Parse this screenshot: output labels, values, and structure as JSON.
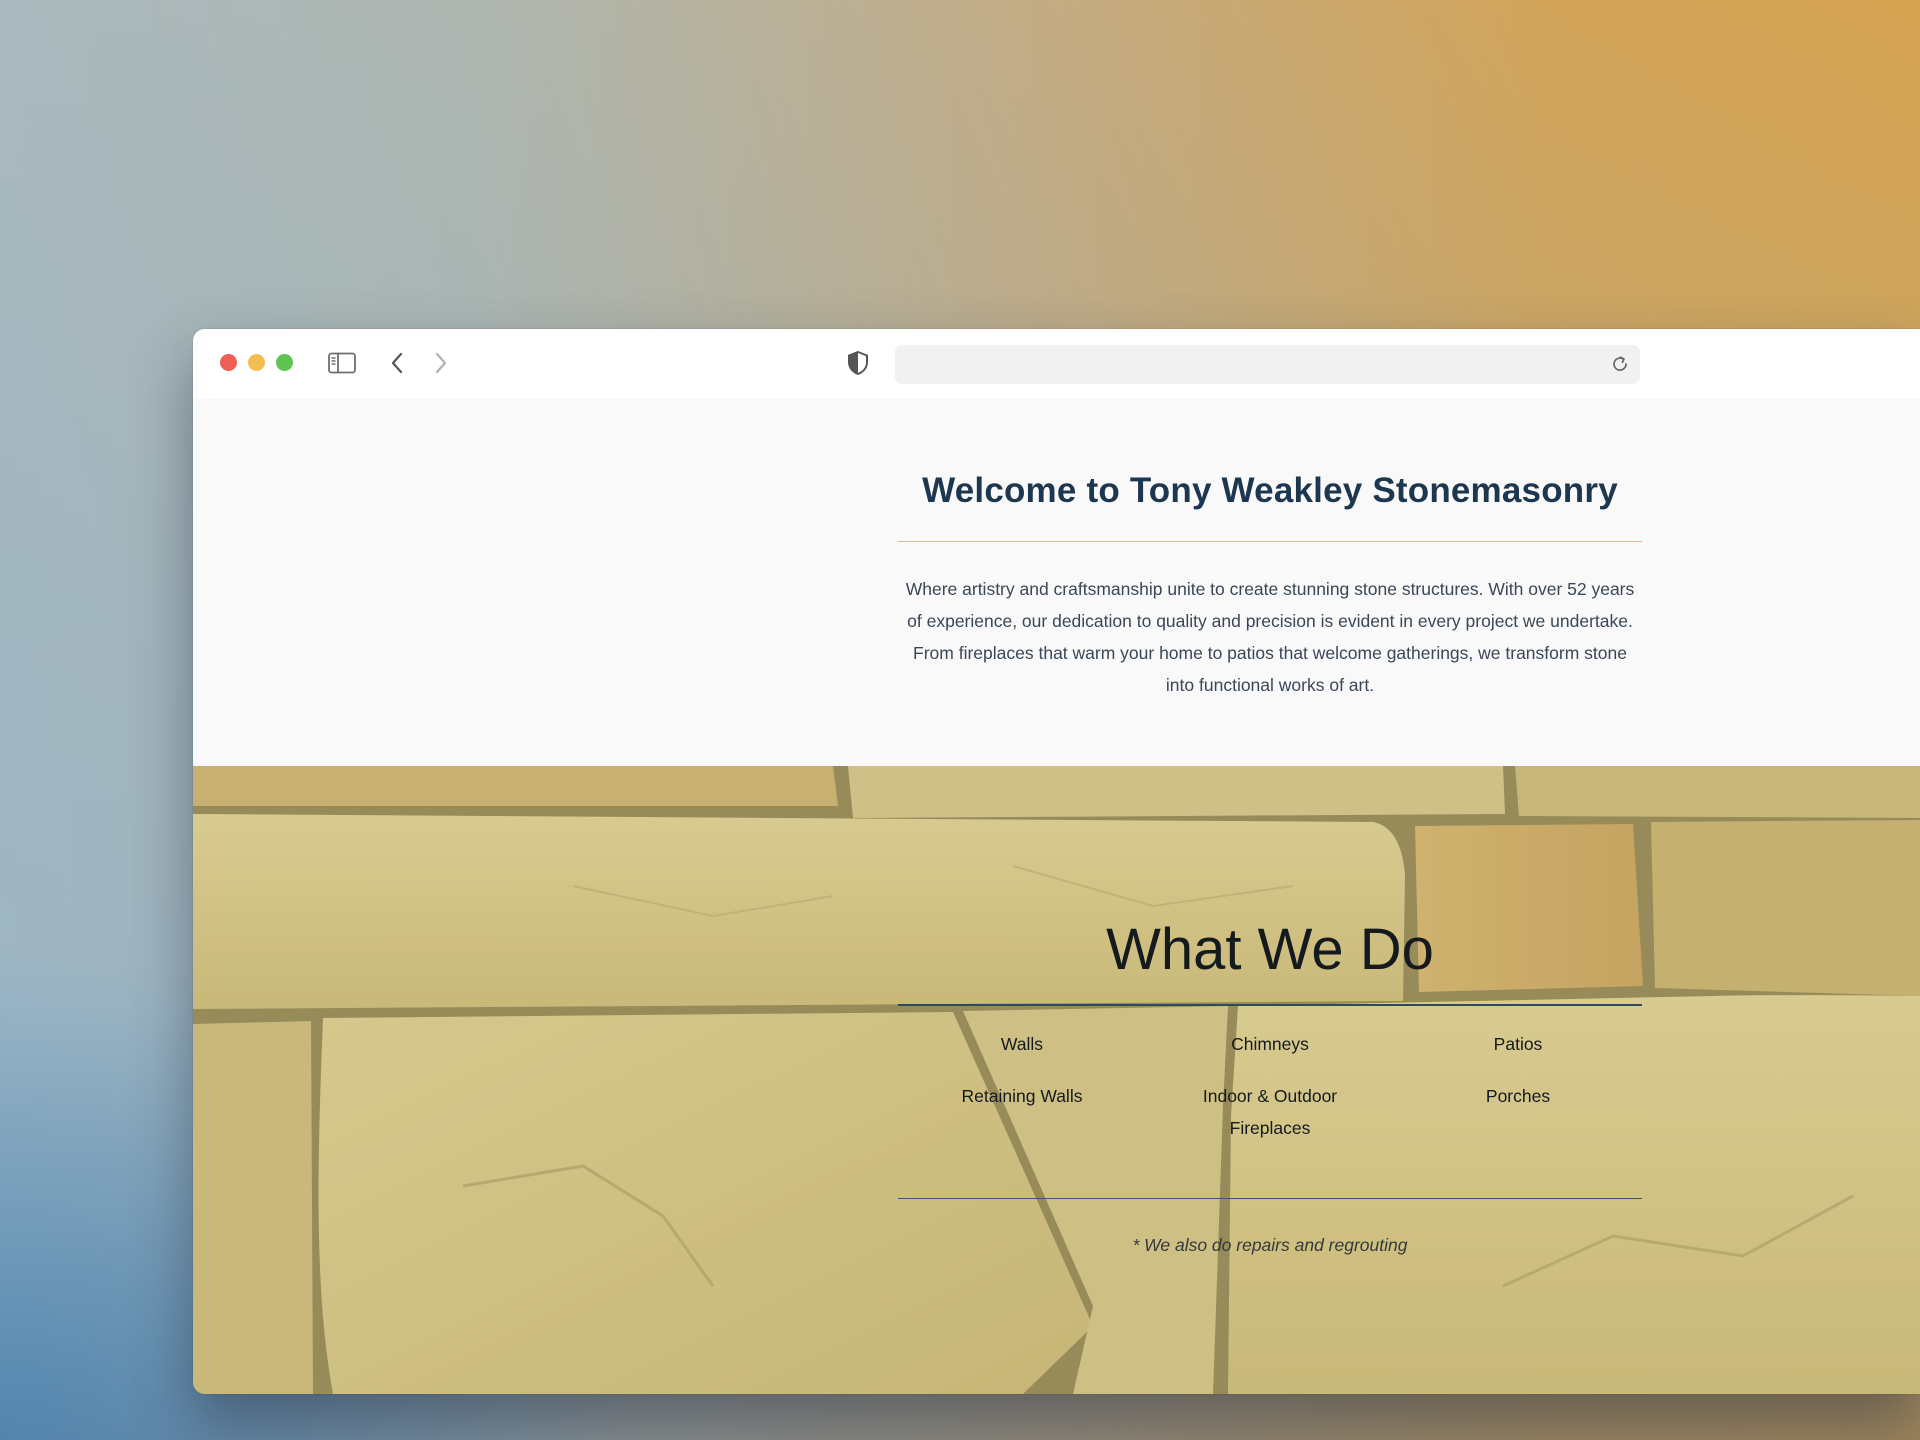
{
  "browser": {
    "address_bar": {
      "value": ""
    }
  },
  "welcome": {
    "title": "Welcome to Tony Weakley Stonemasonry",
    "text": "Where artistry and craftsmanship unite to create stunning stone structures. With over 52 years of experience, our dedication to quality and precision is evident in every project we undertake. From fireplaces that warm your home to patios that welcome gatherings, we transform stone into functional works of art."
  },
  "services": {
    "title": "What We Do",
    "items": [
      {
        "label": "Walls"
      },
      {
        "label": "Chimneys"
      },
      {
        "label": "Patios"
      },
      {
        "label": "Retaining Walls"
      },
      {
        "label": "Indoor & Outdoor Fireplaces"
      },
      {
        "label": "Porches"
      }
    ],
    "note": "* We also do repairs and regrouting"
  },
  "colors": {
    "title_navy": "#1d3750",
    "accent_rule": "#e3b48f",
    "stone": "#c9bb7c"
  }
}
